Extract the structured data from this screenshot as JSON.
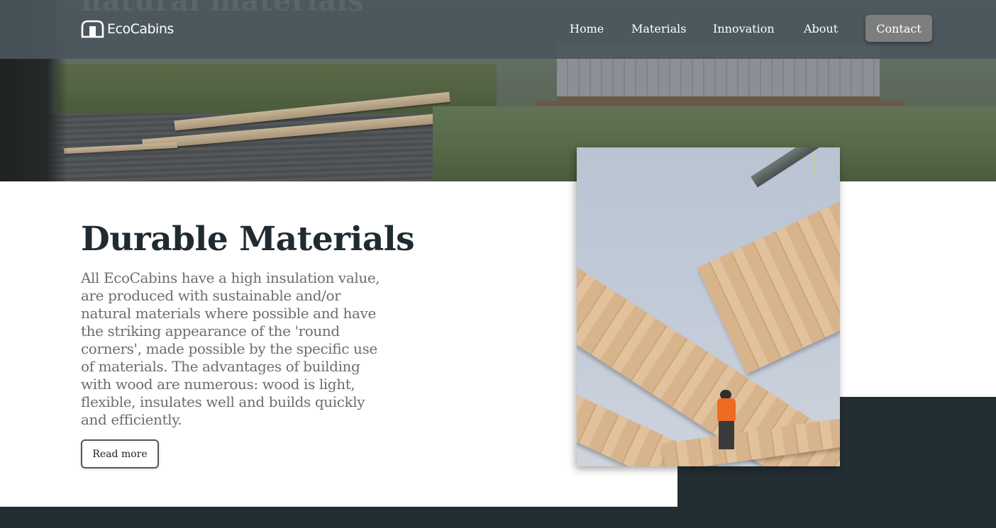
{
  "brand": {
    "name": "EcoCabins",
    "icon": "cabin-logo-icon"
  },
  "hero": {
    "heading_fragment": "natural materials"
  },
  "nav": {
    "links": [
      {
        "label": "Home"
      },
      {
        "label": "Materials"
      },
      {
        "label": "Innovation"
      },
      {
        "label": "About"
      }
    ],
    "contact_label": "Contact"
  },
  "section": {
    "title": "Durable Materials",
    "body": "All EcoCabins have a high insulation value, are produced with sustainable and/or natural materials where possible and have the striking appearance of the 'round corners', made possible by the specific use of materials. The advantages of building with wood are numerous: wood is light, flexible, insulates well and builds quickly and efficiently.",
    "button_label": "Read more"
  },
  "colors": {
    "navbar": "#4a565c",
    "dark_accent": "#232e33",
    "title_text": "#1f2b30",
    "body_text": "#6a6e70",
    "contact_button": "#7c7f7d"
  }
}
